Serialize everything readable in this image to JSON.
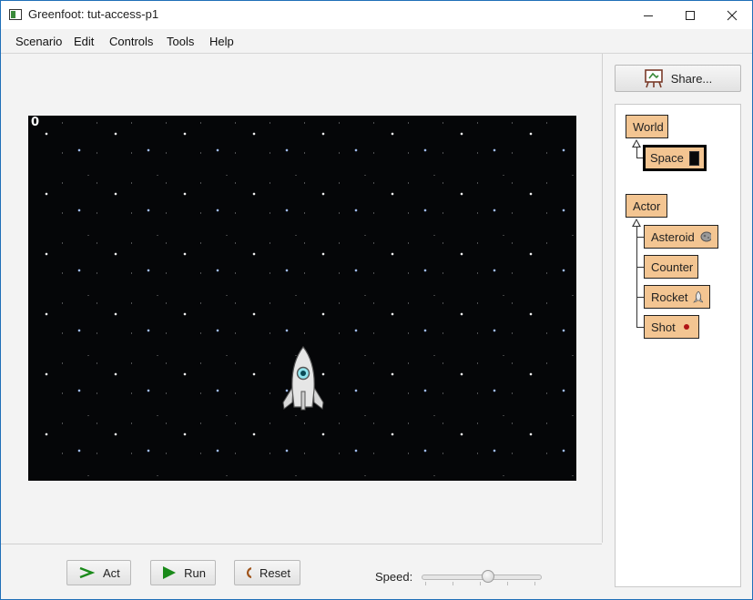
{
  "window": {
    "title": "Greenfoot: tut-access-p1",
    "controls": [
      "minimize-icon",
      "maximize-icon",
      "close-icon"
    ]
  },
  "menu": [
    "Scenario",
    "Edit",
    "Controls",
    "Tools",
    "Help"
  ],
  "world": {
    "score": "0",
    "background": "starfield",
    "actors": [
      "rocket"
    ]
  },
  "controls": {
    "act_label": "Act",
    "run_label": "Run",
    "reset_label": "Reset",
    "speed_label": "Speed:",
    "speed_value": 0.55
  },
  "share": {
    "label": "Share..."
  },
  "classes": {
    "world_root": "World",
    "world_children": [
      {
        "name": "Space",
        "selected": true,
        "image": "space-thumbnail"
      }
    ],
    "actor_root": "Actor",
    "actor_children": [
      {
        "name": "Asteroid",
        "image": "asteroid-thumbnail"
      },
      {
        "name": "Counter",
        "image": ""
      },
      {
        "name": "Rocket",
        "image": "rocket-thumbnail"
      },
      {
        "name": "Shot",
        "image": "shot-thumbnail"
      }
    ]
  },
  "colors": {
    "class_box": "#f3c592",
    "run_green": "#1a8a1a",
    "reset_brown": "#a0541a",
    "world_bg": "#050608",
    "title_border": "#1f6fb8"
  }
}
